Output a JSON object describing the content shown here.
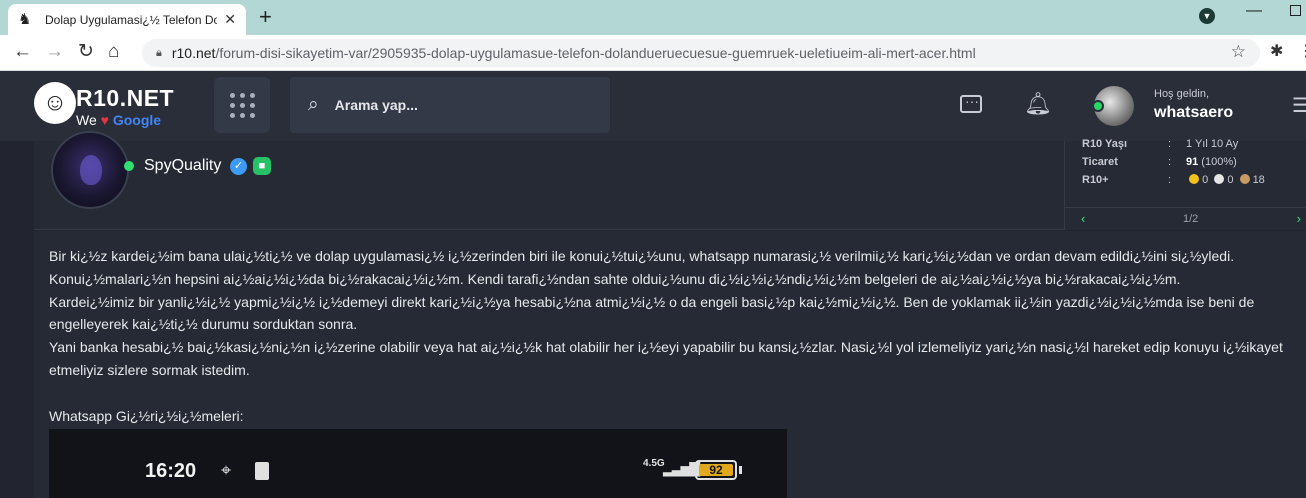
{
  "browser": {
    "tab_title": "Dolap Uygulamasi¿½ Telefon Do",
    "tab_favicon": "r10-favicon-icon",
    "url_host": "r10.net",
    "url_path": "/forum-disi-sikayetim-var/2905935-dolap-uygulamasue-telefon-dolandueruecuesue-guemruek-ueletiueim-ali-mert-acer.html"
  },
  "header": {
    "logo_title": "R10.NET",
    "logo_we": "We",
    "logo_google": "Google",
    "search_placeholder": "Arama yap...",
    "greeting": "Hoş geldin,",
    "username": "whatsaero"
  },
  "post": {
    "author": "SpyQuality",
    "stats": [
      {
        "label": "R10 Yaşı",
        "value": "1 Yıl 10 Ay"
      },
      {
        "label": "Ticaret",
        "value_bold": "91",
        "value_rest": " (100%)"
      },
      {
        "label": "R10+",
        "coins": [
          "0",
          "0",
          "18"
        ]
      }
    ],
    "page_indicator": "1/2",
    "paragraphs": [
      "Bir ki¿½z kardei¿½im bana ulai¿½ti¿½ ve dolap uygulamasi¿½ i¿½zerinden biri ile konui¿½tui¿½unu, whatsapp numarasi¿½ verilmii¿½ kari¿½i¿½dan ve ordan devam edildi¿½ini si¿½yledi.",
      "Konui¿½malari¿½n hepsini ai¿½ai¿½i¿½da bi¿½rakacai¿½i¿½m. Kendi tarafi¿½ndan sahte oldui¿½unu di¿½i¿½i¿½ndi¿½i¿½m belgeleri de ai¿½ai¿½i¿½ya bi¿½rakacai¿½i¿½m.",
      "Kardei¿½imiz bir yanli¿½i¿½ yapmi¿½i¿½ i¿½demeyi direkt kari¿½i¿½ya hesabi¿½na atmi¿½i¿½ o da engeli basi¿½p kai¿½mi¿½i¿½. Ben de yoklamak ii¿½in yazdi¿½i¿½i¿½mda ise beni de engelleyerek kai¿½ti¿½ durumu sorduktan sonra.",
      "Yani banka hesabi¿½ bai¿½kasi¿½ni¿½n i¿½zerine olabilir veya hat ai¿½i¿½k hat olabilir her i¿½eyi yapabilir bu kansi¿½zlar. Nasi¿½l yol izlemeliyiz yari¿½n nasi¿½l hareket edip konuyu i¿½ikayet etmeliyiz sizlere sormak istedim."
    ],
    "whatsapp_label": "Whatsapp Gi¿½ri¿½i¿½meleri:"
  },
  "screenshot": {
    "time": "16:20",
    "network": "4.5G",
    "battery": "92"
  },
  "colors": {
    "accent_green": "#2fe070",
    "verified_blue": "#3e9bf5",
    "page_bg": "#22252f"
  }
}
